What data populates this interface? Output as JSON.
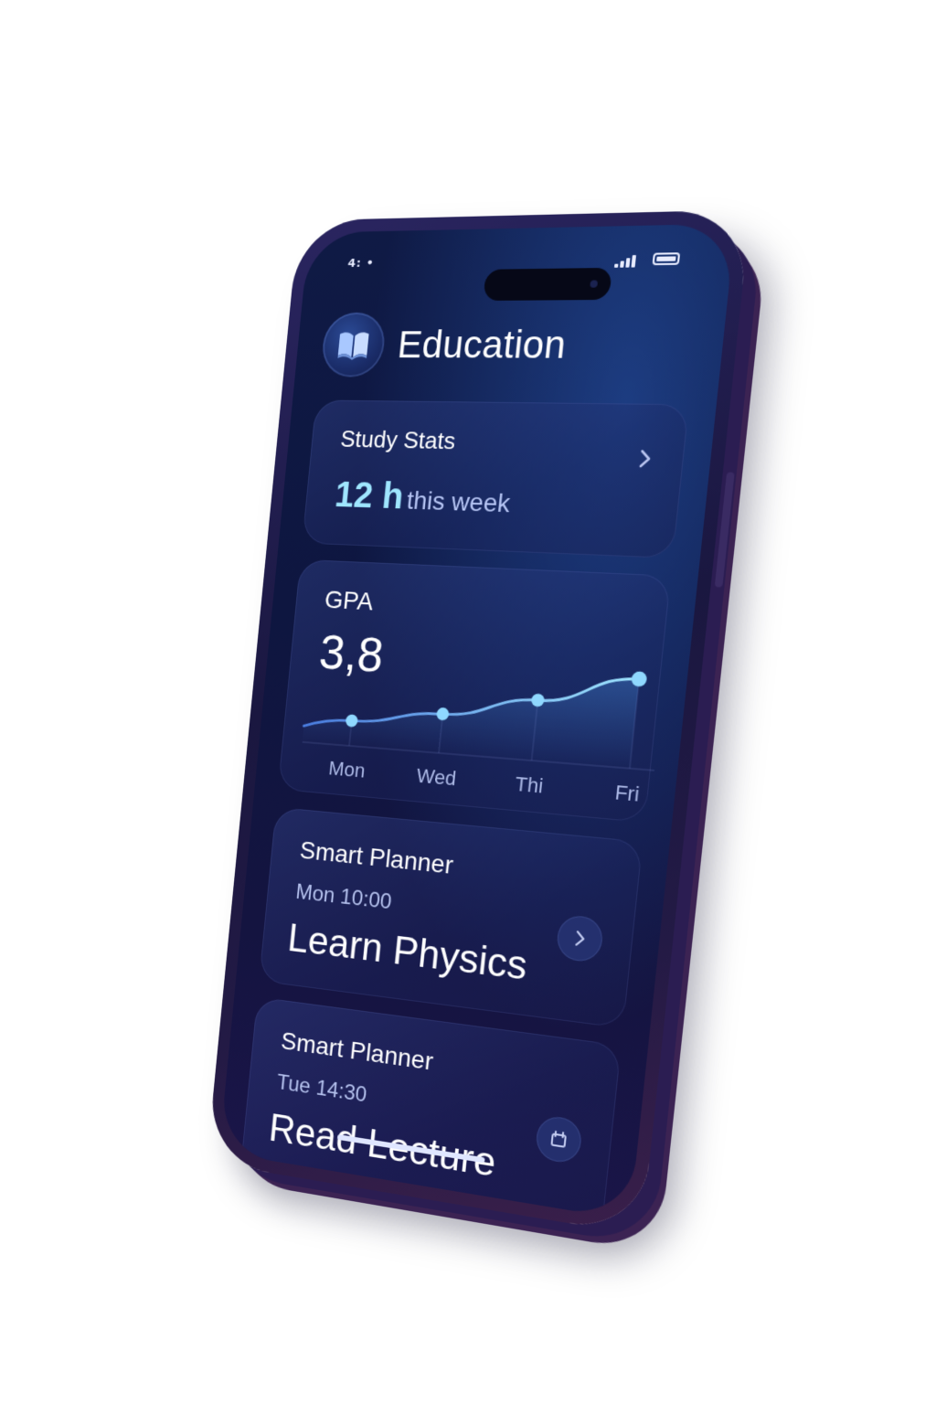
{
  "status_bar": {
    "left_text": "4: •"
  },
  "header": {
    "title": "Education",
    "logo_icon": "open-book-icon"
  },
  "study_stats": {
    "title": "Study Stats",
    "value": "12 h",
    "suffix": "this week"
  },
  "gpa": {
    "title": "GPA",
    "value": "3,8"
  },
  "chart_data": {
    "type": "line",
    "x": [
      "Mon",
      "Wed",
      "Thi",
      "Fri"
    ],
    "values": [
      2.9,
      3.1,
      3.4,
      3.8
    ],
    "ylim": [
      2.6,
      4.0
    ],
    "grid": true,
    "title": "",
    "xlabel": "",
    "ylabel": ""
  },
  "planner_1": {
    "title": "Smart Planner",
    "time": "Mon 10:00",
    "task": "Learn Physics",
    "action_icon": "chevron-right-icon"
  },
  "planner_2": {
    "title": "Smart Planner",
    "time": "Tue 14:30",
    "task": "Read Lecture",
    "action_icon": "calendar-icon"
  },
  "colors": {
    "accent": "#8fd8ff",
    "background": "#0f1a45",
    "text": "#ffffff"
  }
}
